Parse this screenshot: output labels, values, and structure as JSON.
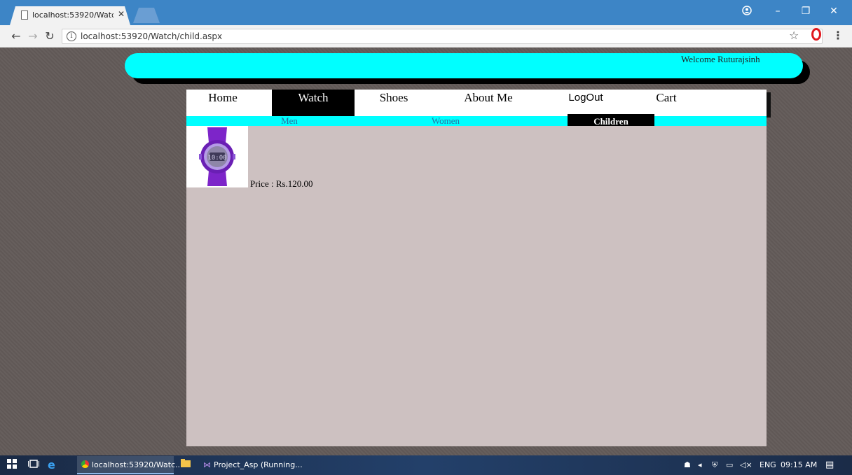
{
  "browser": {
    "tab_title": "localhost:53920/Watch/c",
    "url": "localhost:53920/Watch/child.aspx",
    "accent": "#3d85c6"
  },
  "header": {
    "welcome": "Welcome Ruturajsinh",
    "bar_color": "#00ffff"
  },
  "nav": {
    "items": [
      {
        "label": "Home"
      },
      {
        "label": "Watch"
      },
      {
        "label": "Shoes"
      },
      {
        "label": "About Me"
      },
      {
        "label": "LogOut"
      },
      {
        "label": "Cart"
      }
    ],
    "active": "Watch"
  },
  "subnav": {
    "items": [
      {
        "label": "Men"
      },
      {
        "label": "Women"
      },
      {
        "label": "Children"
      }
    ],
    "active": "Children"
  },
  "products": [
    {
      "price": "Price : Rs.120.00",
      "image": "purple-kids-watch"
    }
  ],
  "taskbar": {
    "apps": [
      {
        "label": "localhost:53920/Watc..."
      },
      {
        "label": "Project_Asp (Running..."
      }
    ],
    "language": "ENG",
    "time": "09:15 AM"
  }
}
